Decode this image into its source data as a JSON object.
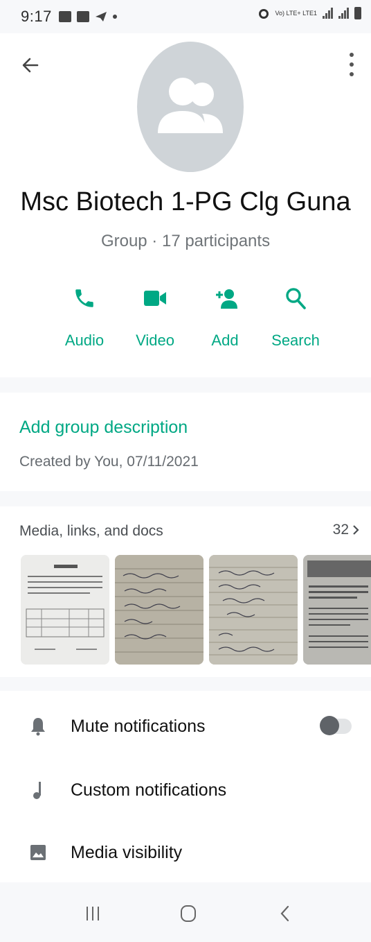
{
  "status_bar": {
    "time": "9:17",
    "network": "Vo) LTE+ LTE1"
  },
  "header": {
    "group_name": "Msc Biotech 1-PG Clg Guna",
    "subtitle": "Group · 17 participants",
    "avatar_icon": "group-avatar-icon",
    "actions": [
      {
        "label": "Audio",
        "icon": "phone-icon"
      },
      {
        "label": "Video",
        "icon": "video-camera-icon"
      },
      {
        "label": "Add",
        "icon": "add-person-icon"
      },
      {
        "label": "Search",
        "icon": "search-icon"
      }
    ]
  },
  "description": {
    "link": "Add group description",
    "created": "Created by You, 07/11/2021"
  },
  "media": {
    "title": "Media, links, and docs",
    "count": "32"
  },
  "settings": {
    "items": [
      {
        "label": "Mute notifications",
        "icon": "bell-icon",
        "toggle": false
      },
      {
        "label": "Custom notifications",
        "icon": "music-note-icon"
      },
      {
        "label": "Media visibility",
        "icon": "image-icon"
      }
    ]
  },
  "colors": {
    "accent": "#00a884",
    "background": "#f7f8fa",
    "card": "#ffffff"
  }
}
